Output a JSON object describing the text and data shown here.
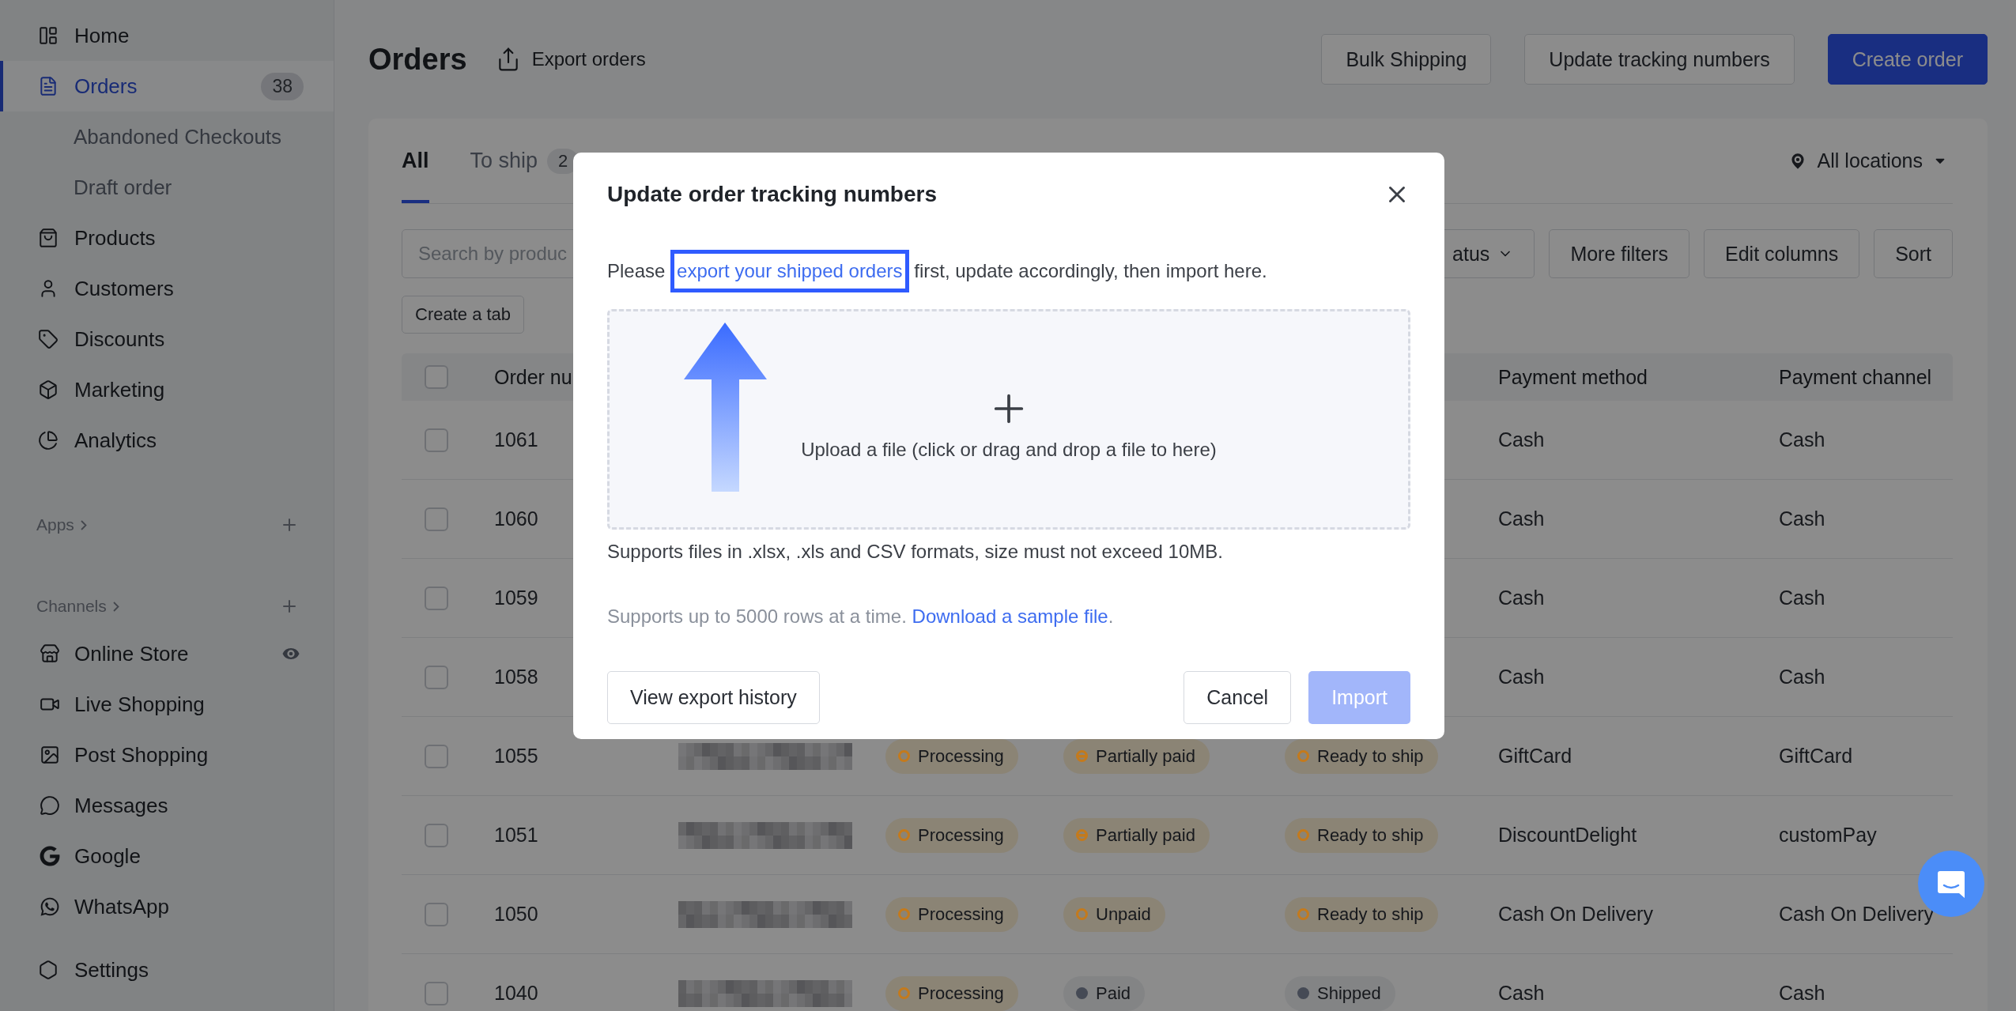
{
  "sidebar": {
    "nav": [
      {
        "label": "Home",
        "kind": "main",
        "selected": false
      },
      {
        "label": "Orders",
        "kind": "main",
        "selected": true,
        "badge": "38"
      },
      {
        "label": "Abandoned Checkouts",
        "kind": "sub",
        "selected": false
      },
      {
        "label": "Draft order",
        "kind": "sub",
        "selected": false
      },
      {
        "label": "Products",
        "kind": "main",
        "selected": false
      },
      {
        "label": "Customers",
        "kind": "main",
        "selected": false
      },
      {
        "label": "Discounts",
        "kind": "main",
        "selected": false
      },
      {
        "label": "Marketing",
        "kind": "main",
        "selected": false
      },
      {
        "label": "Analytics",
        "kind": "main",
        "selected": false
      }
    ],
    "apps": {
      "label": "Apps"
    },
    "channels": {
      "label": "Channels",
      "items": [
        {
          "label": "Online Store"
        },
        {
          "label": "Live Shopping"
        },
        {
          "label": "Post Shopping"
        },
        {
          "label": "Messages"
        },
        {
          "label": "Google"
        },
        {
          "label": "WhatsApp"
        }
      ]
    },
    "settings": {
      "label": "Settings"
    }
  },
  "page": {
    "title": "Orders",
    "export": "Export orders",
    "actions": [
      {
        "label": "Bulk Shipping",
        "primary": false
      },
      {
        "label": "Update tracking numbers",
        "primary": false
      },
      {
        "label": "Create order",
        "primary": true
      }
    ]
  },
  "tabs": [
    {
      "label": "All",
      "selected": true
    },
    {
      "label": "To ship",
      "count": "2",
      "selected": false
    }
  ],
  "location": "All locations",
  "search": {
    "placeholder": "Search by produc"
  },
  "filters": [
    {
      "label": "atus",
      "dropdown": true
    },
    {
      "label": "More filters",
      "dropdown": false
    },
    {
      "label": "Edit columns",
      "dropdown": false
    },
    {
      "label": "Sort",
      "dropdown": false
    }
  ],
  "create_tab": "Create a tab",
  "table": {
    "header_checked": false,
    "columns": [
      "Order nu",
      "Payment method",
      "Payment channel"
    ],
    "rows": [
      {
        "number": "1061",
        "checked": false,
        "method": "Cash",
        "channel": "Cash"
      },
      {
        "number": "1060",
        "checked": false,
        "method": "Cash",
        "channel": "Cash"
      },
      {
        "number": "1059",
        "checked": false,
        "method": "Cash",
        "channel": "Cash"
      },
      {
        "number": "1058",
        "checked": false,
        "method": "Cash",
        "channel": "Cash"
      },
      {
        "number": "1055",
        "checked": false,
        "order_status": {
          "label": "Processing",
          "kind": "ring",
          "color": "#c47a1c"
        },
        "payment_status": {
          "label": "Partially paid",
          "kind": "half",
          "color": "#c47a1c"
        },
        "fulfillment": {
          "label": "Ready to ship",
          "kind": "ring",
          "color": "#c47a1c"
        },
        "method": "GiftCard",
        "channel": "GiftCard"
      },
      {
        "number": "1051",
        "checked": false,
        "order_status": {
          "label": "Processing",
          "kind": "ring",
          "color": "#c47a1c"
        },
        "payment_status": {
          "label": "Partially paid",
          "kind": "half",
          "color": "#c47a1c"
        },
        "fulfillment": {
          "label": "Ready to ship",
          "kind": "ring",
          "color": "#c47a1c"
        },
        "method": "DiscountDelight",
        "channel": "customPay"
      },
      {
        "number": "1050",
        "checked": false,
        "order_status": {
          "label": "Processing",
          "kind": "ring",
          "color": "#c47a1c"
        },
        "payment_status": {
          "label": "Unpaid",
          "kind": "ring",
          "color": "#c47a1c"
        },
        "fulfillment": {
          "label": "Ready to ship",
          "kind": "ring",
          "color": "#c47a1c"
        },
        "method": "Cash On Delivery",
        "channel": "Cash On Delivery"
      },
      {
        "number": "1040",
        "checked": false,
        "order_status": {
          "label": "Processing",
          "kind": "ring",
          "color": "#c47a1c"
        },
        "payment_status": {
          "label": "Paid",
          "kind": "solid",
          "color": "#454a55"
        },
        "fulfillment": {
          "label": "Shipped",
          "kind": "solid",
          "color": "#454a55"
        },
        "method": "Cash",
        "channel": "Cash"
      }
    ]
  },
  "modal": {
    "title": "Update order tracking numbers",
    "intro": {
      "before": "Please ",
      "link": "export your shipped orders",
      "after": " first, update accordingly, then import here.",
      "highlighted": true
    },
    "upload": "Upload a file (click or drag and drop a file to here)",
    "formats": "Supports files in .xlsx, .xls and CSV formats, size must not exceed 10MB.",
    "rows_note": {
      "text": "Supports up to 5000 rows at a time. ",
      "link": "Download a sample file",
      "after": "."
    },
    "buttons": [
      {
        "label": "View export history",
        "kind": "default",
        "disabled": false
      },
      {
        "label": "Cancel",
        "kind": "default",
        "disabled": false
      },
      {
        "label": "Import",
        "kind": "primary",
        "disabled": true
      }
    ]
  }
}
